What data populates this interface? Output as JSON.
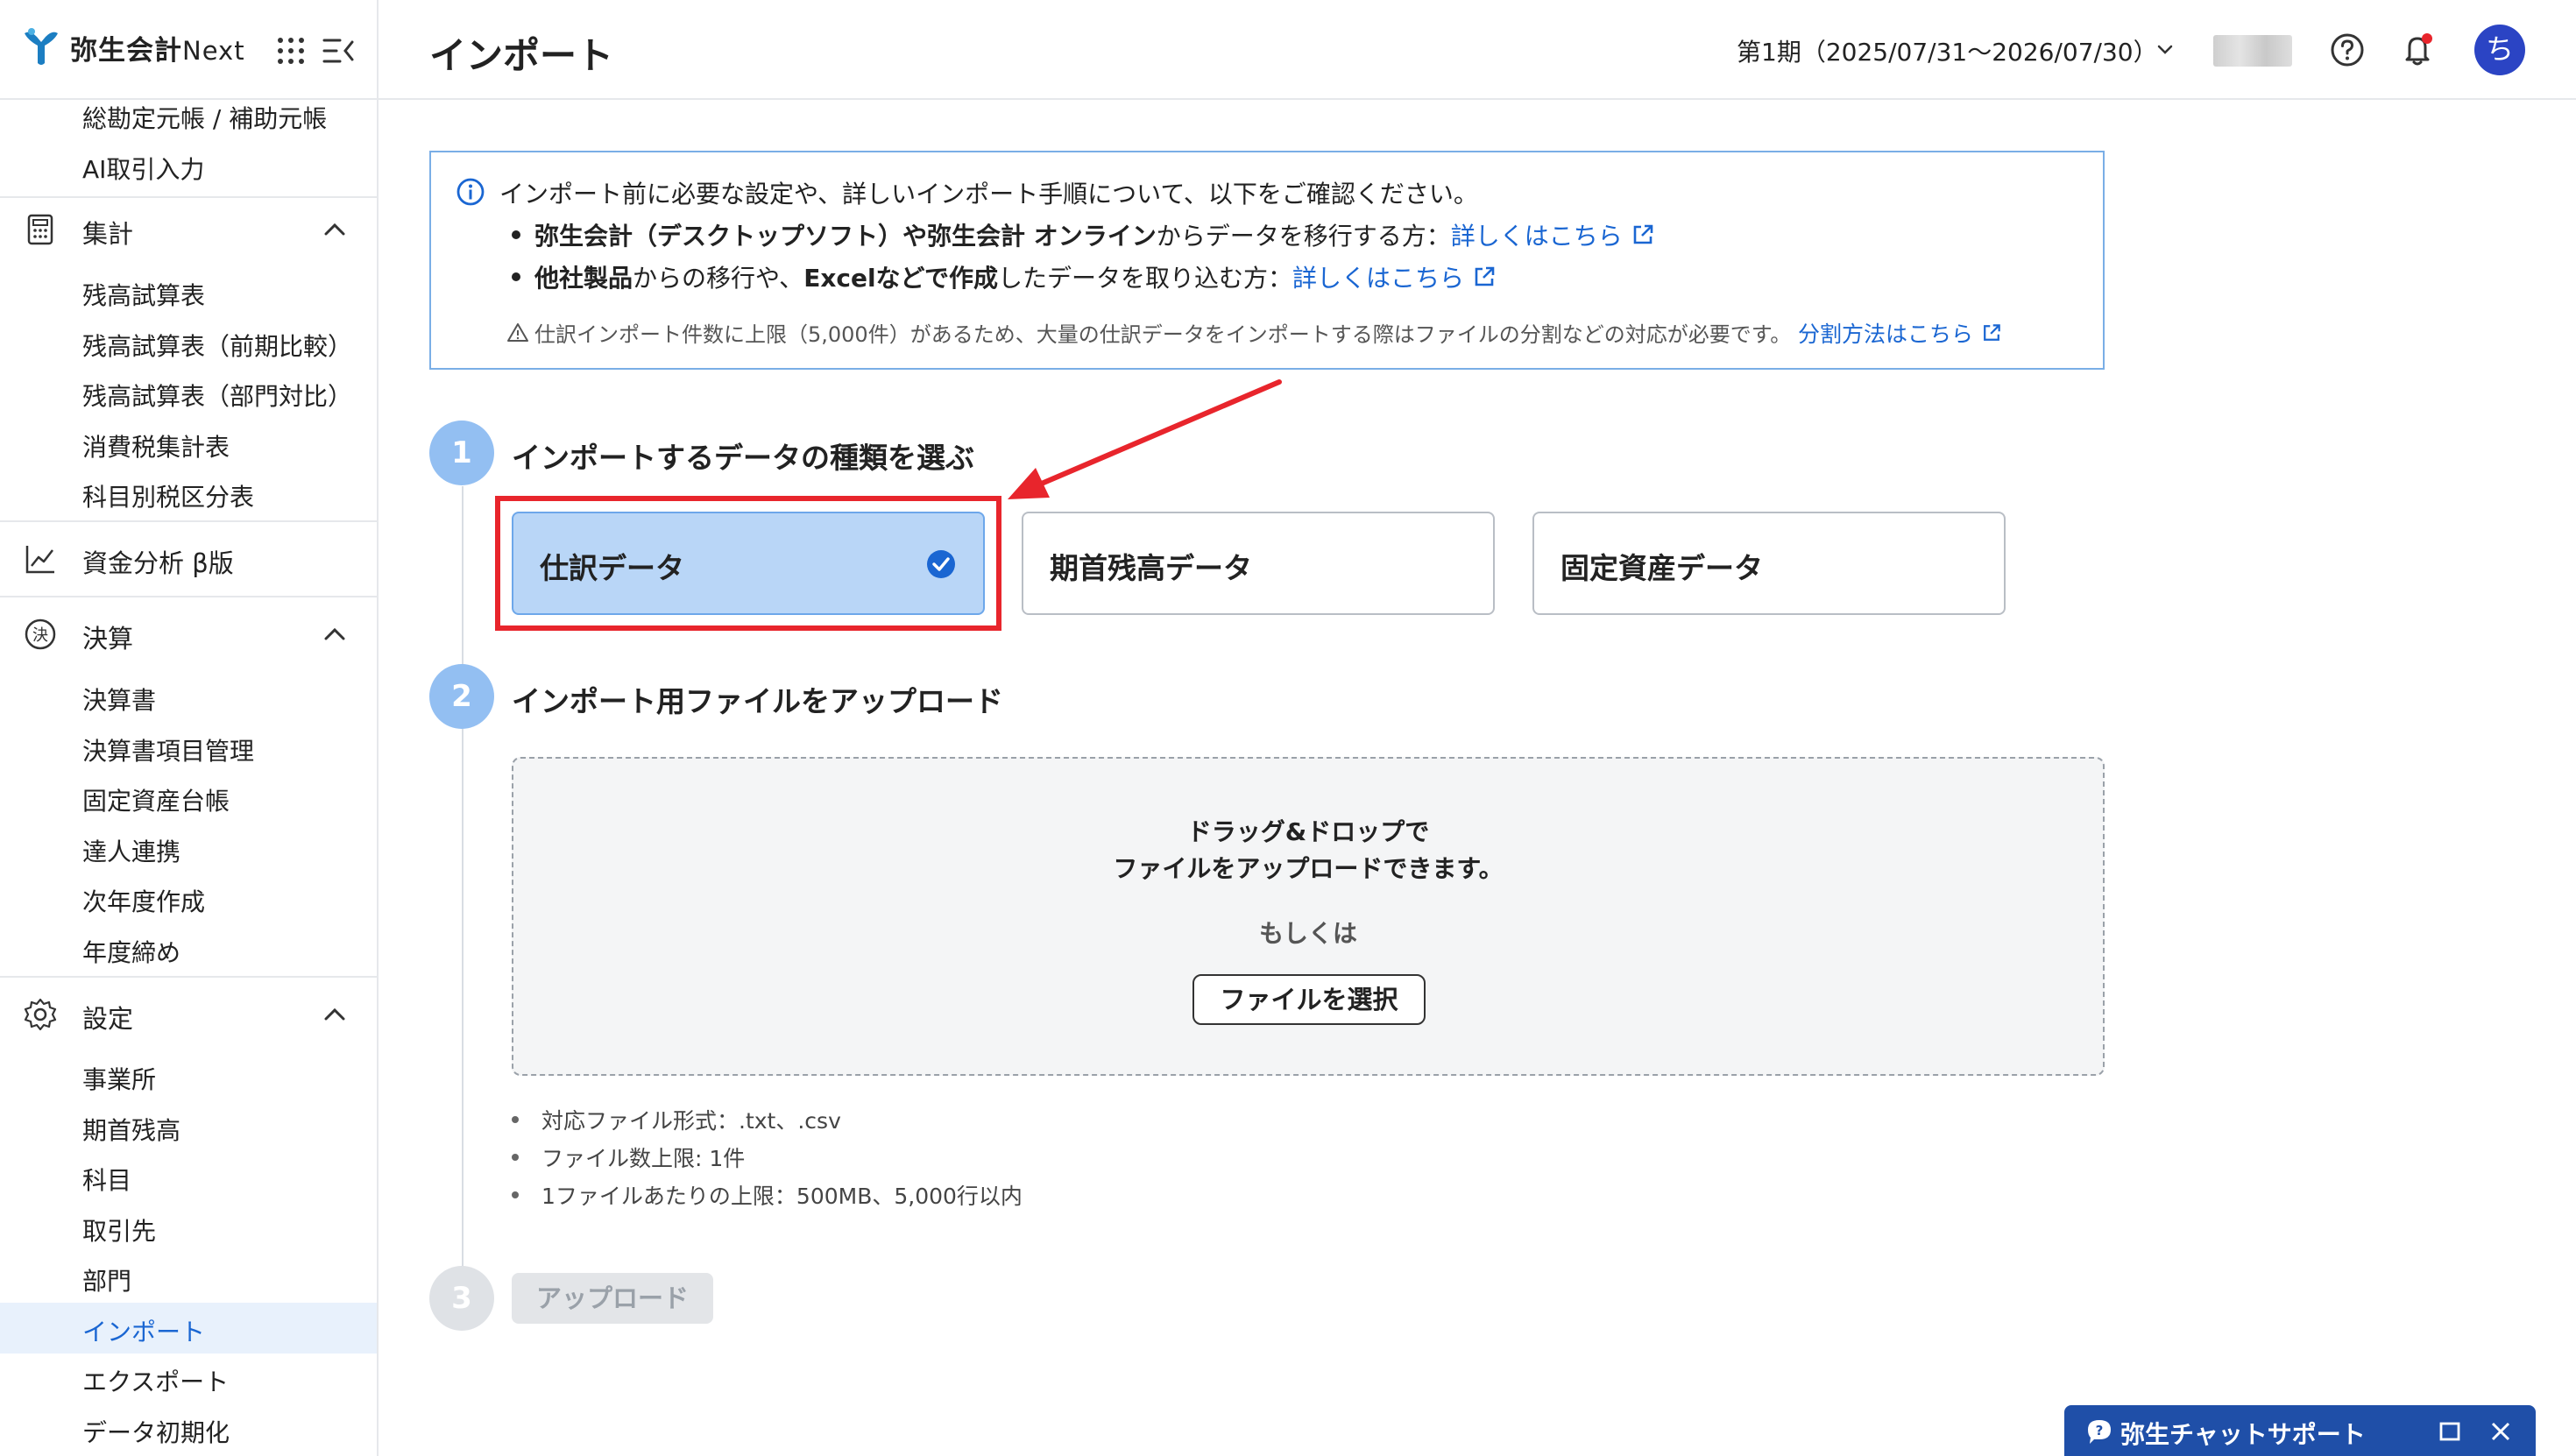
{
  "app": {
    "logo_text": "弥生会計",
    "logo_suffix": "Next"
  },
  "sidebar": {
    "top_items": [
      "総勘定元帳 / 補助元帳",
      "AI取引入力"
    ],
    "groups": {
      "shukei": {
        "label": "集計",
        "items": [
          "残高試算表",
          "残高試算表（前期比較）",
          "残高試算表（部門対比）",
          "消費税集計表",
          "科目別税区分表"
        ]
      },
      "shikin": {
        "label": "資金分析 β版"
      },
      "kessan": {
        "label": "決算",
        "items": [
          "決算書",
          "決算書項目管理",
          "固定資産台帳",
          "達人連携",
          "次年度作成",
          "年度締め"
        ]
      },
      "settei": {
        "label": "設定",
        "items": [
          "事業所",
          "期首残高",
          "科目",
          "取引先",
          "部門",
          "インポート",
          "エクスポート",
          "データ初期化"
        ]
      }
    },
    "active_item": "インポート"
  },
  "header": {
    "title": "インポート",
    "period": "第1期（2025/07/31〜2026/07/30）",
    "avatar_initial": "ち"
  },
  "info": {
    "main": "インポート前に必要な設定や、詳しいインポート手順について、以下をご確認ください。",
    "line1_bold1": "弥生会計（デスクトップソフト）や弥生会計 オンライン",
    "line1_text": "からデータを移行する方：",
    "line1_link": "詳しくはこちら",
    "line2_bold1": "他社製品",
    "line2_text1": "からの移行や、",
    "line2_bold2": "Excelなどで作成",
    "line2_text2": "したデータを取り込む方：",
    "line2_link": "詳しくはこちら",
    "warning": "仕訳インポート件数に上限（5,000件）があるため、大量の仕訳データをインポートする際はファイルの分割などの対応が必要です。",
    "warning_link": "分割方法はこちら"
  },
  "steps": {
    "step1": {
      "number": "1",
      "title": "インポートするデータの種類を選ぶ",
      "options": [
        "仕訳データ",
        "期首残高データ",
        "固定資産データ"
      ],
      "selected": "仕訳データ"
    },
    "step2": {
      "number": "2",
      "title": "インポート用ファイルをアップロード",
      "drop_line1": "ドラッグ&ドロップで",
      "drop_line2": "ファイルをアップロードできます。",
      "or": "もしくは",
      "select_button": "ファイルを選択",
      "notes": [
        "対応ファイル形式：.txt、.csv",
        "ファイル数上限: 1件",
        "1ファイルあたりの上限：500MB、5,000行以内"
      ]
    },
    "step3": {
      "number": "3",
      "upload_button": "アップロード"
    }
  },
  "chat": {
    "label": "弥生チャットサポート"
  },
  "colors": {
    "accent": "#1a66d2",
    "selected_card": "#b9d6f7",
    "highlight": "#e8252c",
    "chat_bar": "#1f4fa8"
  }
}
